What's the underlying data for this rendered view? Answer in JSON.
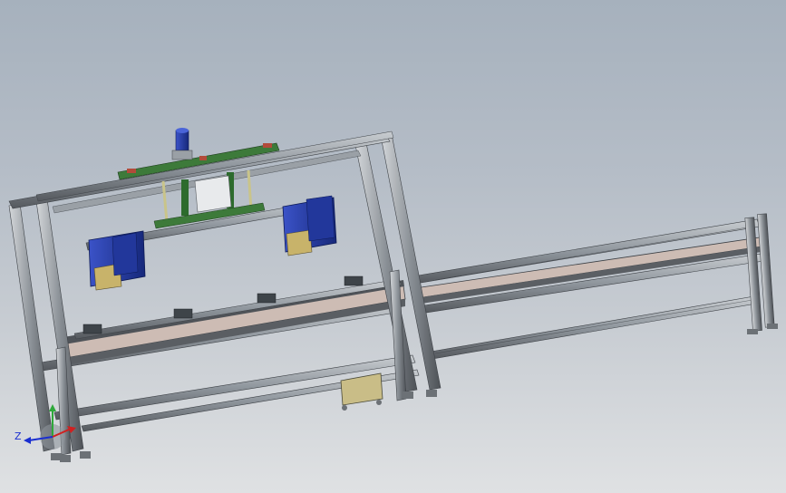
{
  "viewport": {
    "background_top": "#a6b1bd",
    "background_bottom": "#dfe1e3"
  },
  "model": {
    "frame_color": "#8f969d",
    "frame_dark": "#4a5056",
    "cylinder_color": "#1e3a9e",
    "sensor_color": "#c8b36a",
    "belt_color": "#cdbcb4",
    "belt_edge": "#3b3f44",
    "pcb_color": "#3d7a3a",
    "motor_color": "#2a3fb0"
  },
  "triad": {
    "z_label": "Z",
    "x_color": "#1a2fd0",
    "y_color": "#2ea83a",
    "z_color": "#d02020"
  }
}
